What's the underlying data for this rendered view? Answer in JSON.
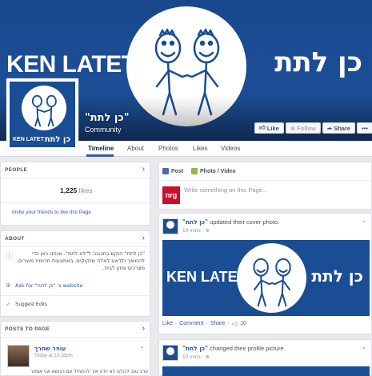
{
  "cover": {
    "brand_en": "KEN LATET",
    "brand_he": "כן לתת",
    "colors": {
      "brand_blue": "#1a4d94",
      "link": "#365899",
      "nrg_red": "#c8102e"
    }
  },
  "page": {
    "name": "\"כן לתת\"",
    "category": "Community",
    "profile_en": "KEN LATET",
    "profile_he": "כן לתת"
  },
  "actions": {
    "like": "Like",
    "follow": "Follow",
    "share": "Share",
    "more": "•••"
  },
  "nav": {
    "tabs": [
      "Timeline",
      "About",
      "Photos",
      "Likes",
      "Videos"
    ],
    "active": "Timeline"
  },
  "people": {
    "title": "PEOPLE",
    "count": "1,225",
    "count_label": "likes",
    "invite": "Invite your friends to like this Page"
  },
  "about": {
    "title": "ABOUT",
    "description": "\"כן לתת\" הוקם בתגובה ל\"לא לתת\". אנחנו כאן כדי להמשיך ולדאוג לאלה שזקוקים, באמצעות תרומת מוצרים, מצרכים ומזון לבית.",
    "ask": "Ask for \"כן לתת\" 's website",
    "suggest": "Suggest Edits"
  },
  "posts_to_page": {
    "title": "POSTS TO PAGE",
    "author": "עופר שחרך",
    "time": "Today at 10:18pm",
    "text": "ערב טוב לכולם לא יודע איך להתחיל עם הנושא אני אספר"
  },
  "composer": {
    "post_tab": "Post",
    "photo_tab": "Photo / Video",
    "avatar_text": "nrg",
    "placeholder": "Write something on this Page..."
  },
  "posts": [
    {
      "author": "\"כן לתת\"",
      "action": "updated their cover photo.",
      "time": "19 mins",
      "image_en": "KEN LATET",
      "image_he": "כן לתת",
      "like": "Like",
      "comment": "Comment",
      "share": "Share",
      "likes_count": "10"
    },
    {
      "author": "\"כן לתת\"",
      "action": "changed their profile picture.",
      "time": "19 mins"
    }
  ]
}
